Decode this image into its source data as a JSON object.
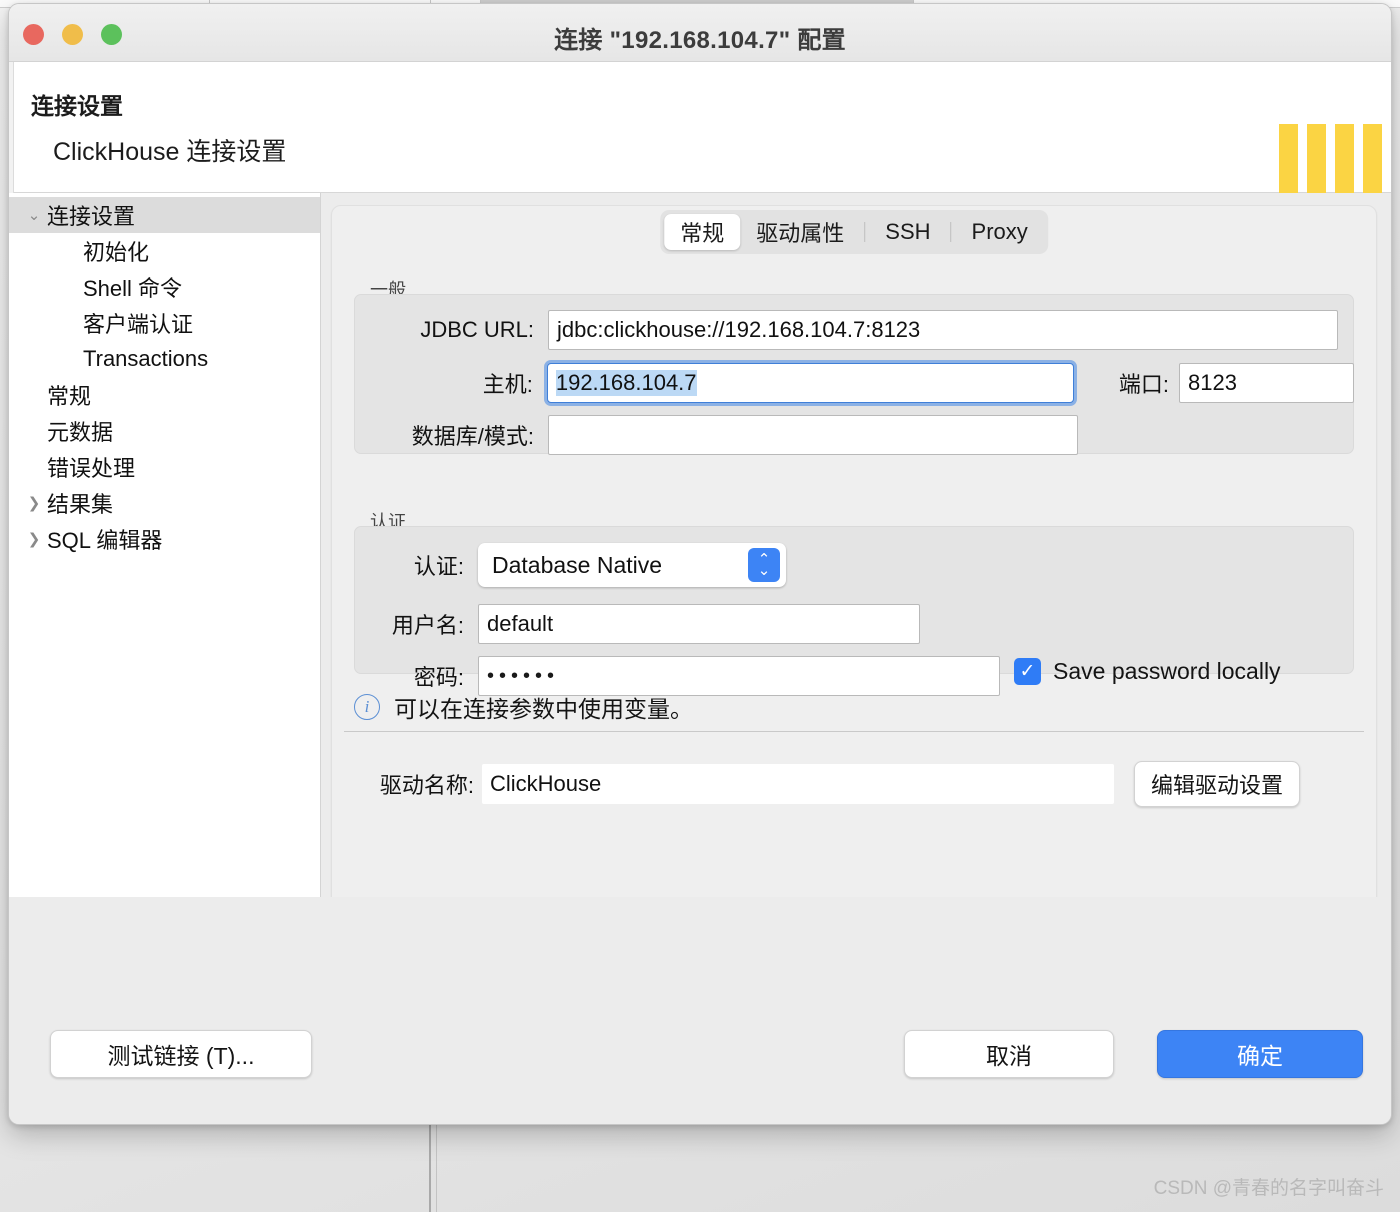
{
  "window": {
    "title": "连接 \"192.168.104.7\" 配置",
    "traffic_lights": [
      "close",
      "minimize",
      "zoom"
    ],
    "colors": {
      "close": "#e8685f",
      "minimize": "#f0bd4a",
      "zoom": "#5cc15c"
    }
  },
  "header": {
    "title": "连接设置",
    "subtitle": "ClickHouse 连接设置",
    "logo": "clickhouse-logo",
    "logo_colors": {
      "bar": "#fbd443",
      "accent": "#ec2f28"
    }
  },
  "sidebar": {
    "items": [
      {
        "label": "连接设置",
        "twisty": "v",
        "level": 0,
        "selected": true
      },
      {
        "label": "初始化",
        "twisty": "",
        "level": 1,
        "selected": false
      },
      {
        "label": "Shell 命令",
        "twisty": "",
        "level": 1,
        "selected": false
      },
      {
        "label": "客户端认证",
        "twisty": "",
        "level": 1,
        "selected": false
      },
      {
        "label": "Transactions",
        "twisty": "",
        "level": 1,
        "selected": false
      },
      {
        "label": "常规",
        "twisty": "",
        "level": 0,
        "selected": false
      },
      {
        "label": "元数据",
        "twisty": "",
        "level": 0,
        "selected": false
      },
      {
        "label": "错误处理",
        "twisty": "",
        "level": 0,
        "selected": false
      },
      {
        "label": "结果集",
        "twisty": ">",
        "level": 0,
        "selected": false
      },
      {
        "label": "SQL 编辑器",
        "twisty": ">",
        "level": 0,
        "selected": false
      }
    ]
  },
  "tabs": [
    {
      "label": "常规",
      "active": true
    },
    {
      "label": "驱动属性",
      "active": false
    },
    {
      "label": "SSH",
      "active": false
    },
    {
      "label": "Proxy",
      "active": false
    }
  ],
  "general": {
    "group_label": "一般",
    "jdbc_url_label": "JDBC URL:",
    "jdbc_url_value": "jdbc:clickhouse://192.168.104.7:8123",
    "host_label": "主机:",
    "host_value": "192.168.104.7",
    "port_label": "端口:",
    "port_value": "8123",
    "database_label": "数据库/模式:",
    "database_value": ""
  },
  "auth": {
    "group_label": "认证",
    "auth_label": "认证:",
    "auth_value": "Database Native",
    "user_label": "用户名:",
    "user_value": "default",
    "password_label": "密码:",
    "password_value": "••••••",
    "save_password_label": "Save password locally",
    "save_password_checked": true,
    "checkmark": "✓"
  },
  "info": {
    "icon": "info-icon",
    "text": "可以在连接参数中使用变量。"
  },
  "driver": {
    "label": "驱动名称:",
    "value": "ClickHouse",
    "edit_button": "编辑驱动设置"
  },
  "footer": {
    "test_button": "测试链接 (T)...",
    "cancel_button": "取消",
    "ok_button": "确定",
    "accent_color": "#3d84f5"
  },
  "watermark": "CSDN @青春的名字叫奋斗"
}
